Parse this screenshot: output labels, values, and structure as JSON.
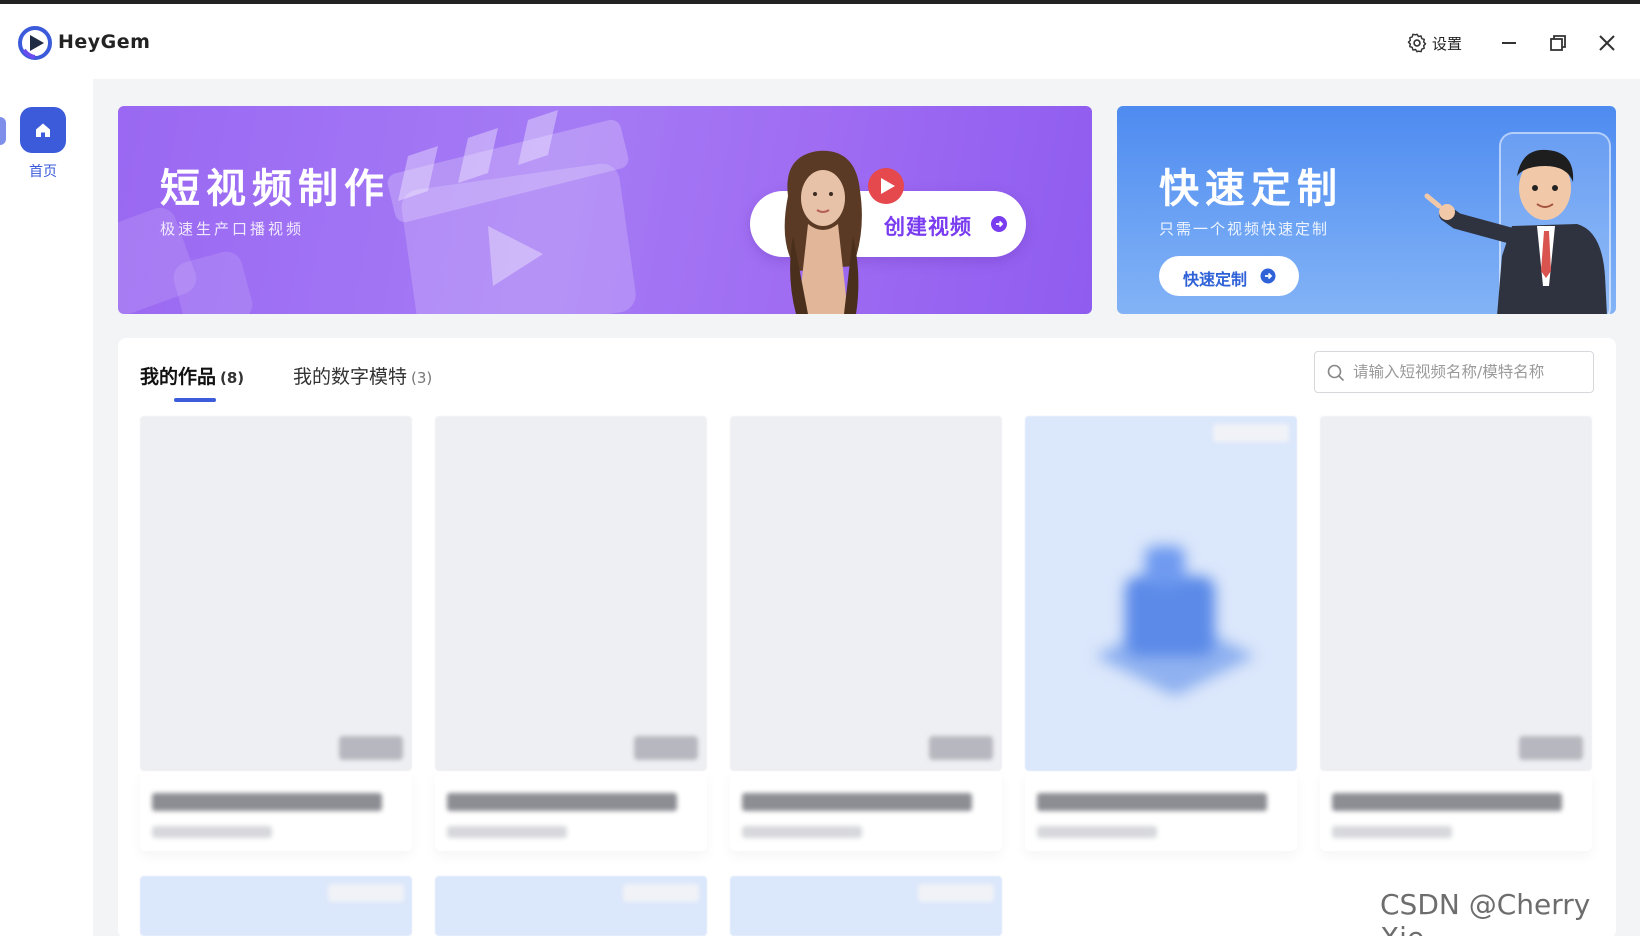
{
  "app": {
    "name": "HeyGem",
    "settings_label": "设置"
  },
  "sidebar": {
    "items": [
      {
        "label": "首页",
        "icon": "home-icon",
        "active": true
      }
    ]
  },
  "banners": {
    "video": {
      "title": "短视频制作",
      "subtitle": "极速生产口播视频",
      "cta_label": "创建视频"
    },
    "custom": {
      "title": "快速定制",
      "subtitle": "只需一个视频快速定制",
      "cta_label": "快速定制"
    }
  },
  "tabs": [
    {
      "label": "我的作品",
      "count": "(8)",
      "active": true
    },
    {
      "label": "我的数字模特",
      "count": "(3)",
      "active": false
    }
  ],
  "search": {
    "placeholder": "请输入短视频名称/模特名称"
  },
  "cards": [
    {
      "style": "gray"
    },
    {
      "style": "gray"
    },
    {
      "style": "gray"
    },
    {
      "style": "blue"
    },
    {
      "style": "gray"
    },
    {
      "style": "blue"
    },
    {
      "style": "blue"
    },
    {
      "style": "blue"
    }
  ],
  "watermark": "CSDN @Cherry Xie",
  "colors": {
    "accent": "#3b5bdb",
    "banner_purple": "#9a68f2",
    "banner_blue": "#4e8bf0"
  }
}
